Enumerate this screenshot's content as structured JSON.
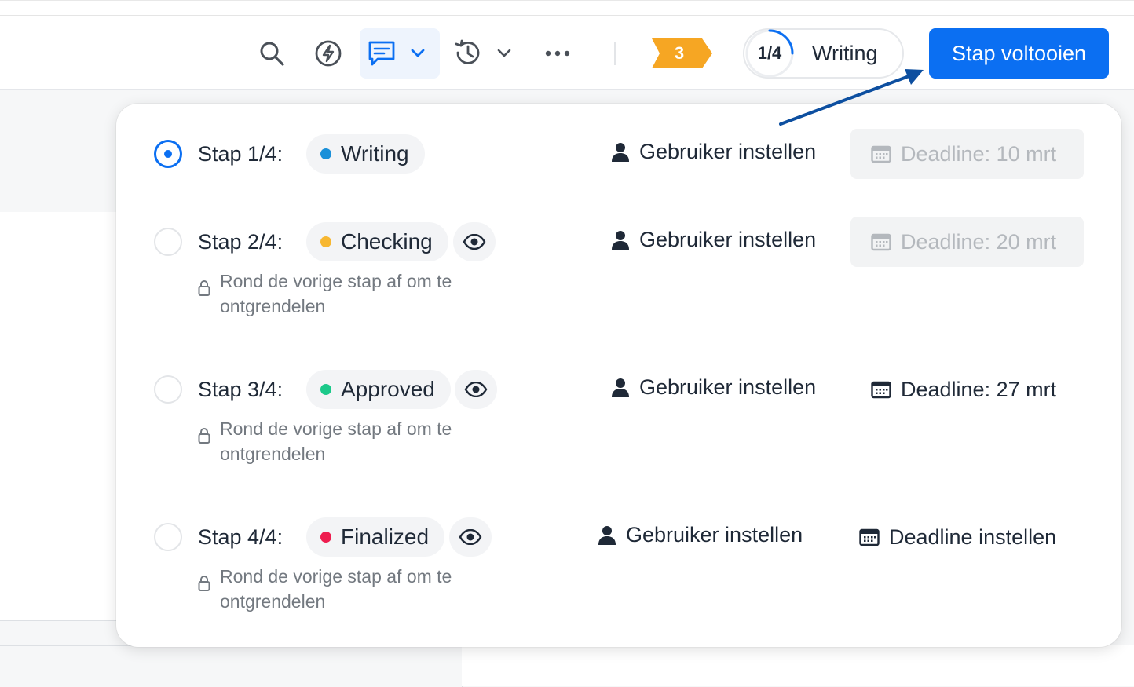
{
  "toolbar": {
    "icons": [
      "search-icon",
      "lightning-icon",
      "chat-icon",
      "chevron-down-icon",
      "history-icon",
      "chevron-down-icon",
      "more-icon"
    ],
    "notification_count": "3",
    "progress": {
      "fraction_label": "1/4",
      "fraction_value": 0.25,
      "stage": "Writing"
    },
    "complete_button": "Stap voltooien"
  },
  "colors": {
    "primary": "#0b6ff2",
    "badge": "#f6a623",
    "writing": "#1a90d9",
    "checking": "#f7b731",
    "approved": "#1cc98a",
    "finalized": "#ee1d4f"
  },
  "steps": [
    {
      "label": "Stap 1/4:",
      "status": "Writing",
      "status_color": "#1a90d9",
      "active": true,
      "has_eye": false,
      "locked_note": "",
      "user": "Gebruiker instellen",
      "deadline": "Deadline: 10 mrt",
      "deadline_disabled": true
    },
    {
      "label": "Stap 2/4:",
      "status": "Checking",
      "status_color": "#f7b731",
      "active": false,
      "has_eye": true,
      "locked_note": "Rond de vorige stap af om te ontgrendelen",
      "user": "Gebruiker instellen",
      "deadline": "Deadline: 20 mrt",
      "deadline_disabled": true
    },
    {
      "label": "Stap 3/4:",
      "status": "Approved",
      "status_color": "#1cc98a",
      "active": false,
      "has_eye": true,
      "locked_note": "Rond de vorige stap af om te ontgrendelen",
      "user": "Gebruiker instellen",
      "deadline": "Deadline: 27 mrt",
      "deadline_disabled": false
    },
    {
      "label": "Stap 4/4:",
      "status": "Finalized",
      "status_color": "#ee1d4f",
      "active": false,
      "has_eye": true,
      "locked_note": "Rond de vorige stap af om te ontgrendelen",
      "user": "Gebruiker instellen",
      "deadline": "Deadline instellen",
      "deadline_disabled": false
    }
  ]
}
